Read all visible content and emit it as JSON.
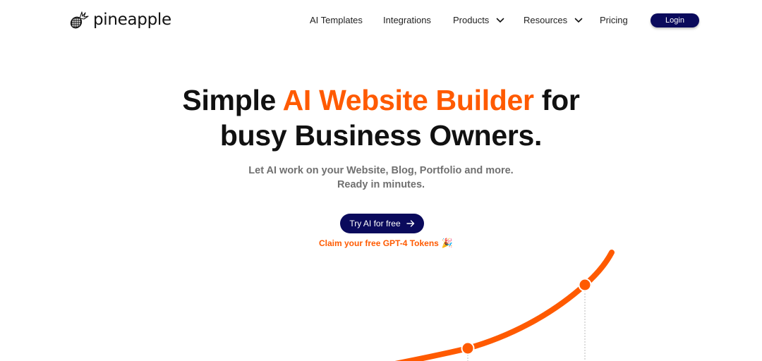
{
  "brand": {
    "name": "pineapple",
    "icon": "pineapple-icon",
    "accent_color": "#ff5a00",
    "primary_color": "#0a0a5c"
  },
  "nav": {
    "items": [
      {
        "label": "AI Templates",
        "has_dropdown": false
      },
      {
        "label": "Integrations",
        "has_dropdown": false
      },
      {
        "label": "Products",
        "has_dropdown": true
      },
      {
        "label": "Resources",
        "has_dropdown": true
      },
      {
        "label": "Pricing",
        "has_dropdown": false
      }
    ],
    "login_label": "Login"
  },
  "hero": {
    "title_part1": "Simple ",
    "title_accent": "AI Website Builder",
    "title_part2": " for",
    "title_line2": "busy Business Owners.",
    "subtitle_line1": "Let AI work on your Website, Blog, Portfolio and more.",
    "subtitle_line2": "Ready in minutes.",
    "cta_label": "Try AI for free",
    "cta_icon": "arrow-right-icon",
    "claim_label": "Claim your free GPT-4 Tokens",
    "claim_emoji": "🎉"
  },
  "decoration": {
    "type": "growth-curve",
    "color": "#ff5a00",
    "markers": 2
  }
}
